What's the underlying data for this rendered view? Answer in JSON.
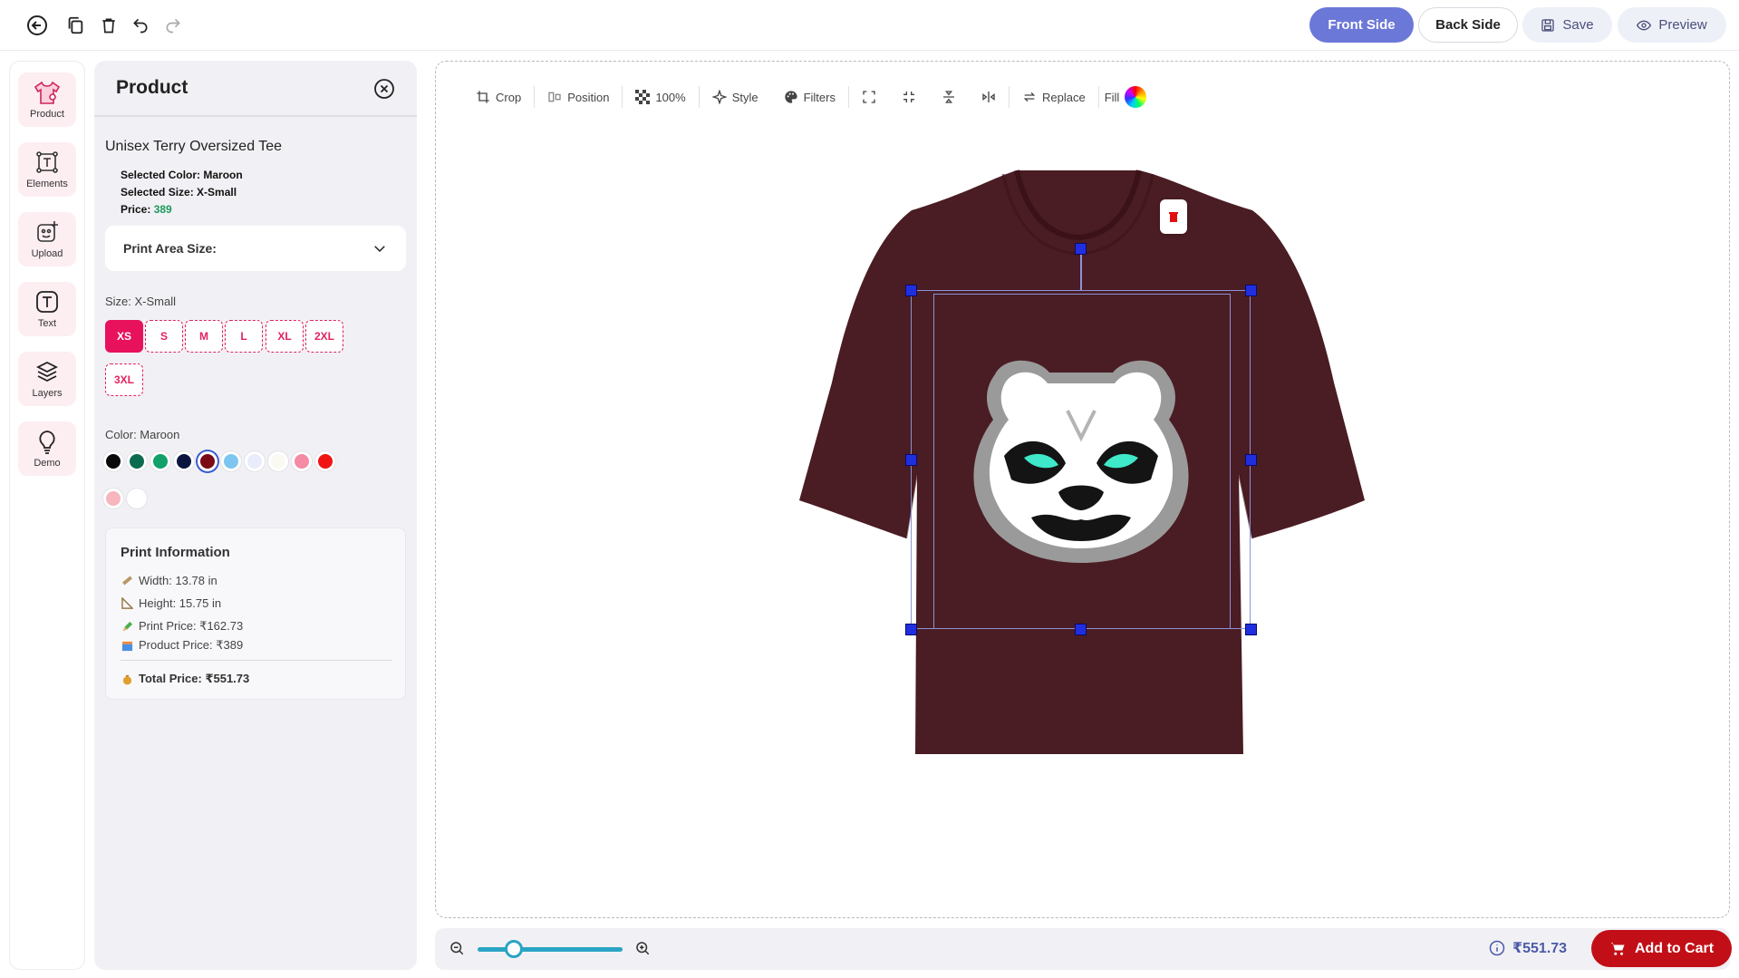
{
  "toolbar_top": {
    "front_label": "Front Side",
    "back_label": "Back Side",
    "save_label": "Save",
    "preview_label": "Preview",
    "icons": [
      "back-arrow-icon",
      "duplicate-icon",
      "trash-icon",
      "undo-icon",
      "redo-icon"
    ]
  },
  "rail": {
    "items": [
      {
        "label": "Product",
        "icon": "tshirt-icon"
      },
      {
        "label": "Elements",
        "icon": "elements-icon"
      },
      {
        "label": "Upload",
        "icon": "upload-image-icon"
      },
      {
        "label": "Text",
        "icon": "text-icon"
      },
      {
        "label": "Layers",
        "icon": "layers-icon"
      },
      {
        "label": "Demo",
        "icon": "lightbulb-icon"
      }
    ]
  },
  "panel": {
    "title": "Product",
    "product_name": "Unisex Terry Oversized Tee",
    "selected_color": "Selected Color: Maroon",
    "selected_size": "Selected Size: X-Small",
    "price_label": "Price:",
    "price_value": "389",
    "print_area_label": "Print Area Size:",
    "size_label": "Size: X-Small",
    "sizes": [
      "XS",
      "S",
      "M",
      "L",
      "XL",
      "2XL",
      "3XL"
    ],
    "selected_size_index": 0,
    "color_label": "Color: Maroon",
    "colors": [
      "#0a0a0a",
      "#0b6b4f",
      "#12a06b",
      "#0c1440",
      "#7a0a14",
      "#7cc6ef",
      "#e8ecfb",
      "#fbfaf2",
      "#f48aa4",
      "#f01414",
      "#f7b5bd",
      "#ffffff"
    ],
    "selected_color_index": 4,
    "print_info": {
      "title": "Print Information",
      "width": "Width: 13.78 in",
      "height": "Height: 15.75 in",
      "print_price": "Print Price: ₹162.73",
      "product_price": "Product Price: ₹389",
      "total_price": "Total Price: ₹551.73"
    }
  },
  "canvas_toolbar": {
    "crop": "Crop",
    "position": "Position",
    "opacity": "100%",
    "style": "Style",
    "filters": "Filters",
    "replace": "Replace",
    "fill": "Fill"
  },
  "shirt_color": "#4a1c23",
  "bottom": {
    "price": "₹551.73",
    "cart_label": "Add to Cart",
    "zoom_level": 0.25
  },
  "accent": {
    "primary": "#6c78d8",
    "pink": "#e8115b",
    "cart": "#c20f17",
    "handle": "#1f2fe0"
  }
}
